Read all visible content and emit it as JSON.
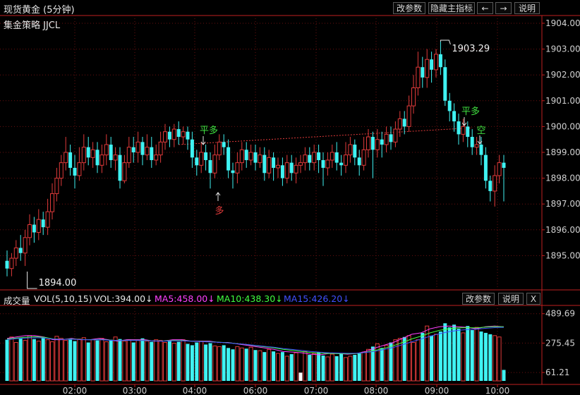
{
  "app": {
    "title": "现货黄金 (5分钟)",
    "strategy": "集金策略 JJCL",
    "buttons": {
      "params": "改参数",
      "hide_indicator": "隐藏主指标",
      "left": "←",
      "right": "→",
      "help": "说明"
    }
  },
  "volume_panel": {
    "name": "成交量",
    "indicator": "VOL(5,10,15)",
    "vol": "VOL:394.00↓",
    "ma5": "MA5:458.00↓",
    "ma10": "MA10:438.30↓",
    "ma15": "MA15:426.20↓",
    "buttons": {
      "params": "改参数",
      "help": "说明",
      "close": "X"
    }
  },
  "colors": {
    "up": "#e03a3a",
    "down": "#3ff2f2",
    "ma5": "#ff40ff",
    "ma10": "#40ff40",
    "ma15": "#4050ff",
    "signal": "#40e040",
    "buy": "#e03a3a"
  },
  "chart_data": {
    "type": "candlestick",
    "price_axis": {
      "ticks": [
        1895,
        1896,
        1897,
        1898,
        1899,
        1900,
        1901,
        1902,
        1903,
        1904
      ],
      "labels": [
        "1895.00",
        "1896.00",
        "1897.00",
        "1898.00",
        "1899.00",
        "1900.00",
        "1901.00",
        "1902.00",
        "1903.00",
        "1904.00"
      ],
      "range": [
        1893.7,
        1904.3
      ]
    },
    "volume_axis": {
      "ticks": [
        61.21,
        275.45,
        489.69
      ],
      "labels": [
        "61.21",
        "275.45",
        "489.69"
      ],
      "range": [
        0,
        550
      ]
    },
    "time_labels": [
      "02:00",
      "03:00",
      "04:00",
      "06:00",
      "07:00",
      "08:00",
      "09:00",
      "10:00"
    ],
    "annotations": {
      "high": "1903.29",
      "low": "1894.00",
      "flat1": "平多",
      "flat2": "平多",
      "short": "空",
      "long": "多"
    },
    "candles": [
      [
        1894.8,
        1894.5,
        1895.2,
        1894.2
      ],
      [
        1894.5,
        1894.9,
        1895.1,
        1894.2
      ],
      [
        1894.9,
        1895.3,
        1895.6,
        1894.6
      ],
      [
        1895.3,
        1895.1,
        1895.8,
        1894.8
      ],
      [
        1895.1,
        1895.7,
        1896.0,
        1894.6
      ],
      [
        1895.7,
        1896.2,
        1896.6,
        1895.4
      ],
      [
        1896.2,
        1895.9,
        1896.5,
        1895.5
      ],
      [
        1895.9,
        1896.4,
        1896.8,
        1895.6
      ],
      [
        1896.4,
        1896.1,
        1896.7,
        1895.8
      ],
      [
        1896.1,
        1896.7,
        1897.2,
        1895.8
      ],
      [
        1896.7,
        1897.4,
        1897.8,
        1896.4
      ],
      [
        1897.4,
        1898.0,
        1898.4,
        1897.1
      ],
      [
        1898.0,
        1898.6,
        1898.9,
        1897.7
      ],
      [
        1898.6,
        1899.0,
        1899.6,
        1898.3
      ],
      [
        1899.0,
        1898.4,
        1899.3,
        1898.1
      ],
      [
        1898.4,
        1898.1,
        1898.9,
        1897.6
      ],
      [
        1898.1,
        1898.6,
        1899.2,
        1897.9
      ],
      [
        1898.6,
        1899.2,
        1899.7,
        1898.3
      ],
      [
        1899.2,
        1898.8,
        1899.6,
        1898.5
      ],
      [
        1898.8,
        1899.1,
        1899.4,
        1898.4
      ],
      [
        1899.1,
        1898.5,
        1899.4,
        1898.2
      ],
      [
        1898.5,
        1898.9,
        1899.3,
        1898.2
      ],
      [
        1898.9,
        1899.3,
        1899.7,
        1898.5
      ],
      [
        1899.3,
        1898.7,
        1899.6,
        1898.4
      ],
      [
        1898.7,
        1898.9,
        1899.2,
        1898.3
      ],
      [
        1898.9,
        1897.9,
        1899.2,
        1897.6
      ],
      [
        1897.9,
        1898.6,
        1898.9,
        1897.8
      ],
      [
        1898.6,
        1899.2,
        1899.6,
        1898.4
      ],
      [
        1899.2,
        1899.0,
        1899.6,
        1898.6
      ],
      [
        1899.0,
        1899.4,
        1899.8,
        1898.6
      ],
      [
        1899.4,
        1898.9,
        1899.6,
        1898.5
      ],
      [
        1898.9,
        1899.2,
        1899.7,
        1898.7
      ],
      [
        1899.2,
        1898.7,
        1899.6,
        1898.4
      ],
      [
        1898.7,
        1898.9,
        1899.3,
        1898.5
      ],
      [
        1898.9,
        1899.4,
        1899.8,
        1898.6
      ],
      [
        1899.4,
        1899.8,
        1900.1,
        1899.1
      ],
      [
        1899.8,
        1899.5,
        1900.0,
        1899.2
      ],
      [
        1899.5,
        1899.9,
        1900.1,
        1899.2
      ],
      [
        1899.9,
        1899.6,
        1900.2,
        1899.3
      ],
      [
        1899.6,
        1899.8,
        1900.0,
        1899.3
      ],
      [
        1899.8,
        1899.5,
        1900.0,
        1899.1
      ],
      [
        1899.5,
        1898.8,
        1899.8,
        1898.4
      ],
      [
        1898.8,
        1898.5,
        1899.1,
        1898.1
      ],
      [
        1898.5,
        1899.0,
        1899.4,
        1898.2
      ],
      [
        1899.0,
        1898.7,
        1899.3,
        1898.3
      ],
      [
        1898.7,
        1898.2,
        1899.0,
        1897.6
      ],
      [
        1898.2,
        1898.9,
        1899.3,
        1898.0
      ],
      [
        1898.9,
        1899.4,
        1899.7,
        1898.7
      ],
      [
        1899.4,
        1899.2,
        1899.7,
        1898.9
      ],
      [
        1899.2,
        1898.3,
        1899.5,
        1898.0
      ],
      [
        1898.3,
        1898.2,
        1898.6,
        1897.6
      ],
      [
        1898.2,
        1898.6,
        1899.0,
        1897.8
      ],
      [
        1898.6,
        1899.1,
        1899.4,
        1898.3
      ],
      [
        1899.1,
        1898.7,
        1899.4,
        1898.4
      ],
      [
        1898.7,
        1899.0,
        1899.3,
        1898.5
      ],
      [
        1899.0,
        1898.6,
        1899.3,
        1898.3
      ],
      [
        1898.6,
        1898.9,
        1899.2,
        1898.4
      ],
      [
        1898.9,
        1898.2,
        1899.2,
        1897.9
      ],
      [
        1898.2,
        1898.8,
        1899.1,
        1898.0
      ],
      [
        1898.8,
        1898.4,
        1899.0,
        1897.9
      ],
      [
        1898.4,
        1898.5,
        1898.8,
        1898.0
      ],
      [
        1898.5,
        1898.0,
        1898.8,
        1897.7
      ],
      [
        1898.0,
        1898.6,
        1898.9,
        1897.8
      ],
      [
        1898.6,
        1898.2,
        1898.9,
        1897.9
      ],
      [
        1898.2,
        1898.5,
        1898.8,
        1897.8
      ],
      [
        1898.5,
        1898.6,
        1898.9,
        1898.2
      ],
      [
        1898.6,
        1898.9,
        1899.2,
        1898.3
      ],
      [
        1898.9,
        1898.6,
        1899.2,
        1898.3
      ],
      [
        1898.6,
        1899.0,
        1899.3,
        1898.3
      ],
      [
        1899.0,
        1898.7,
        1899.3,
        1898.2
      ],
      [
        1898.7,
        1898.4,
        1899.0,
        1897.7
      ],
      [
        1898.4,
        1898.7,
        1899.0,
        1898.1
      ],
      [
        1898.7,
        1899.0,
        1899.3,
        1898.4
      ],
      [
        1899.0,
        1898.6,
        1899.4,
        1898.3
      ],
      [
        1898.6,
        1898.5,
        1898.9,
        1898.1
      ],
      [
        1898.5,
        1898.9,
        1899.4,
        1898.2
      ],
      [
        1898.9,
        1899.3,
        1899.6,
        1898.6
      ],
      [
        1899.3,
        1898.8,
        1899.5,
        1898.5
      ],
      [
        1898.8,
        1898.5,
        1899.1,
        1898.1
      ],
      [
        1898.5,
        1899.1,
        1899.6,
        1898.3
      ],
      [
        1899.1,
        1899.6,
        1899.9,
        1898.8
      ],
      [
        1899.6,
        1899.1,
        1899.8,
        1898.0
      ],
      [
        1899.1,
        1899.5,
        1899.9,
        1898.8
      ],
      [
        1899.5,
        1899.3,
        1899.8,
        1898.8
      ],
      [
        1899.3,
        1899.7,
        1900.0,
        1899.0
      ],
      [
        1899.7,
        1899.4,
        1900.0,
        1899.1
      ],
      [
        1899.4,
        1899.9,
        1900.2,
        1899.2
      ],
      [
        1899.9,
        1900.3,
        1900.6,
        1899.6
      ],
      [
        1900.3,
        1900.0,
        1900.6,
        1899.7
      ],
      [
        1900.0,
        1900.8,
        1901.2,
        1899.8
      ],
      [
        1900.8,
        1901.5,
        1902.0,
        1900.5
      ],
      [
        1901.5,
        1902.3,
        1902.9,
        1901.2
      ],
      [
        1902.3,
        1901.9,
        1902.7,
        1901.5
      ],
      [
        1901.9,
        1902.6,
        1903.0,
        1901.5
      ],
      [
        1902.6,
        1902.2,
        1902.9,
        1901.7
      ],
      [
        1902.2,
        1902.8,
        1903.0,
        1901.9
      ],
      [
        1902.8,
        1902.3,
        1903.29,
        1902.0
      ],
      [
        1902.3,
        1901.0,
        1902.6,
        1900.8
      ],
      [
        1901.0,
        1900.6,
        1901.3,
        1900.2
      ],
      [
        1900.6,
        1900.2,
        1900.9,
        1899.8
      ],
      [
        1900.2,
        1899.7,
        1900.5,
        1899.3
      ],
      [
        1899.7,
        1900.0,
        1900.3,
        1899.4
      ],
      [
        1900.0,
        1899.6,
        1900.2,
        1899.2
      ],
      [
        1899.6,
        1899.2,
        1899.9,
        1898.9
      ],
      [
        1899.2,
        1899.3,
        1899.6,
        1898.9
      ],
      [
        1899.3,
        1898.9,
        1899.6,
        1898.5
      ],
      [
        1898.9,
        1897.9,
        1899.2,
        1897.6
      ],
      [
        1897.9,
        1897.5,
        1898.1,
        1897.1
      ],
      [
        1897.5,
        1898.1,
        1898.5,
        1896.9
      ],
      [
        1898.1,
        1898.6,
        1898.9,
        1897.8
      ],
      [
        1898.6,
        1898.4,
        1898.9,
        1897.1
      ]
    ],
    "volumes": [
      300,
      320,
      280,
      310,
      295,
      330,
      305,
      290,
      315,
      300,
      285,
      325,
      310,
      295,
      300,
      290,
      305,
      315,
      280,
      300,
      295,
      310,
      285,
      300,
      320,
      305,
      290,
      300,
      280,
      295,
      310,
      290,
      285,
      300,
      295,
      280,
      290,
      275,
      285,
      300,
      270,
      260,
      280,
      290,
      265,
      275,
      255,
      250,
      260,
      240,
      230,
      250,
      240,
      235,
      245,
      225,
      220,
      210,
      230,
      215,
      200,
      210,
      180,
      195,
      205,
      60,
      215,
      190,
      200,
      210,
      185,
      175,
      195,
      180,
      200,
      170,
      180,
      190,
      200,
      210,
      230,
      250,
      270,
      240,
      260,
      280,
      300,
      310,
      320,
      330,
      280,
      300,
      350,
      400,
      330,
      340,
      360,
      420,
      390,
      410,
      380,
      350,
      400,
      370,
      390,
      360,
      350,
      340,
      330,
      320,
      80
    ],
    "ma_lines": {
      "MA5": [
        310,
        320,
        330,
        330,
        320,
        300,
        300,
        310,
        300,
        300,
        310,
        300,
        290,
        300,
        300,
        300,
        290,
        290,
        300,
        300,
        290,
        290,
        290,
        280,
        280,
        270,
        260,
        250,
        240,
        230,
        215,
        210,
        205,
        195,
        190,
        200,
        200,
        195,
        200,
        215,
        240,
        260,
        280,
        310,
        340,
        350,
        380,
        395,
        400,
        395,
        390,
        380,
        395,
        400,
        395
      ],
      "MA10": [
        305,
        312,
        318,
        322,
        318,
        306,
        303,
        306,
        302,
        300,
        302,
        298,
        294,
        296,
        296,
        296,
        292,
        291,
        294,
        294,
        290,
        288,
        286,
        282,
        278,
        272,
        265,
        257,
        249,
        241,
        230,
        222,
        214,
        207,
        202,
        200,
        199,
        198,
        200,
        208,
        222,
        238,
        256,
        280,
        306,
        326,
        350,
        368,
        380,
        386,
        388,
        386,
        392,
        396,
        394
      ],
      "MA15": [
        300,
        308,
        312,
        315,
        313,
        305,
        303,
        304,
        301,
        299,
        300,
        297,
        294,
        295,
        295,
        294,
        292,
        290,
        292,
        292,
        289,
        287,
        284,
        281,
        277,
        271,
        266,
        259,
        252,
        245,
        236,
        229,
        222,
        215,
        209,
        205,
        203,
        201,
        202,
        207,
        216,
        229,
        244,
        264,
        285,
        305,
        326,
        344,
        358,
        368,
        374,
        377,
        383,
        388,
        390
      ]
    },
    "trend_line": {
      "from_price": 1899.3,
      "to_price": 1899.95
    }
  }
}
